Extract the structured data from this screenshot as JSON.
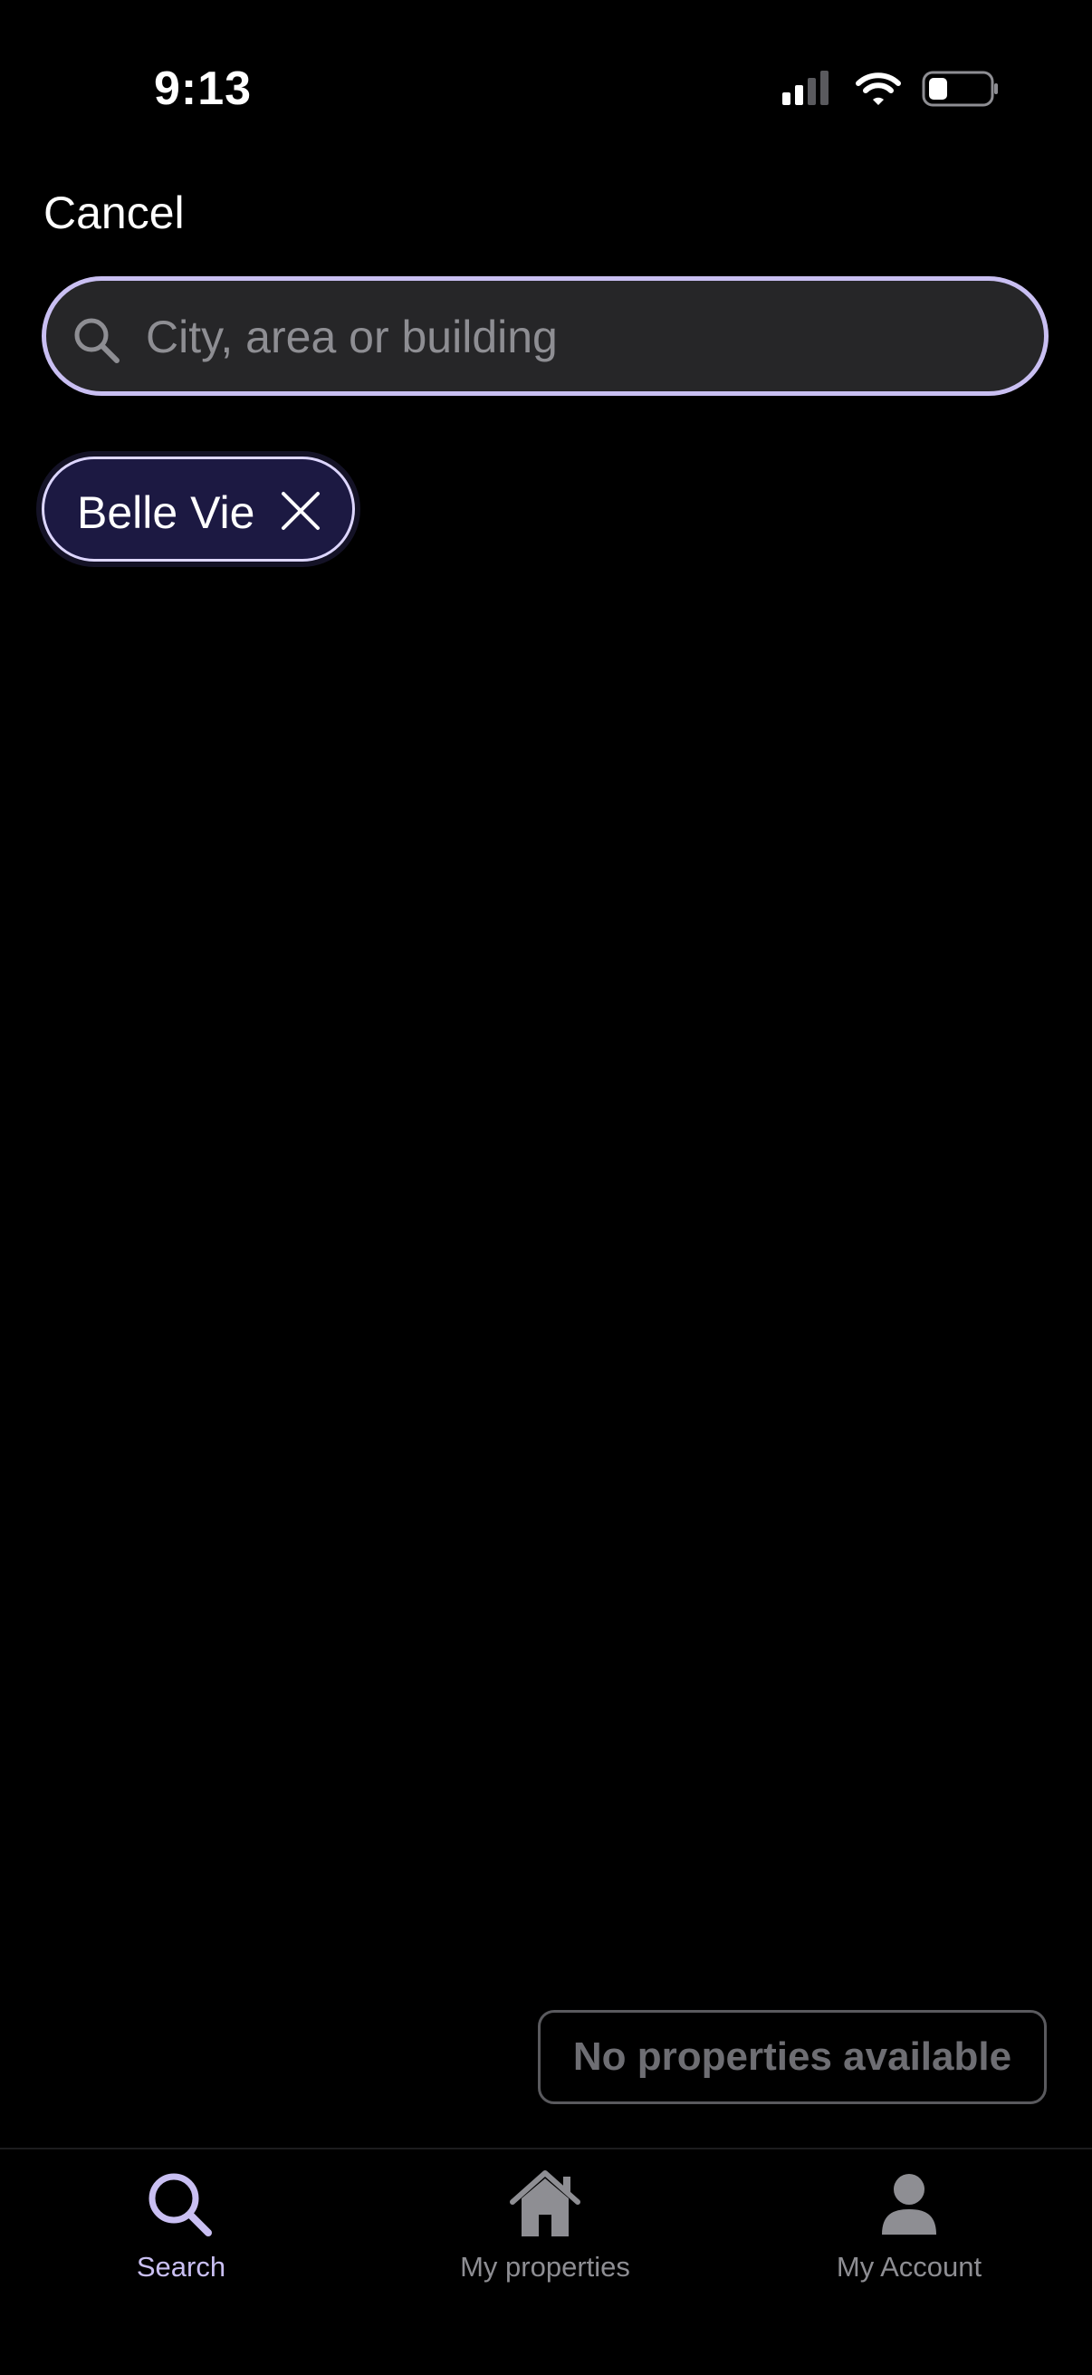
{
  "status_bar": {
    "time": "9:13",
    "icons": [
      "cellular-signal-icon",
      "wifi-icon",
      "battery-icon"
    ]
  },
  "header": {
    "cancel_label": "Cancel"
  },
  "search": {
    "placeholder": "City, area or building",
    "value": "",
    "icon": "search-icon"
  },
  "filters": {
    "chips": [
      {
        "label": "Belle Vie",
        "icon": "close-icon"
      }
    ]
  },
  "results": {
    "empty_message": "No properties available"
  },
  "tab_bar": {
    "tabs": [
      {
        "label": "Search",
        "icon": "search-icon",
        "active": true
      },
      {
        "label": "My properties",
        "icon": "home-icon",
        "active": false
      },
      {
        "label": "My Account",
        "icon": "person-icon",
        "active": false
      }
    ]
  },
  "colors": {
    "background": "#000000",
    "accent": "#c9bff2",
    "chip_background": "#1c1942",
    "input_background": "#262628",
    "muted_text": "#8e8e93"
  }
}
